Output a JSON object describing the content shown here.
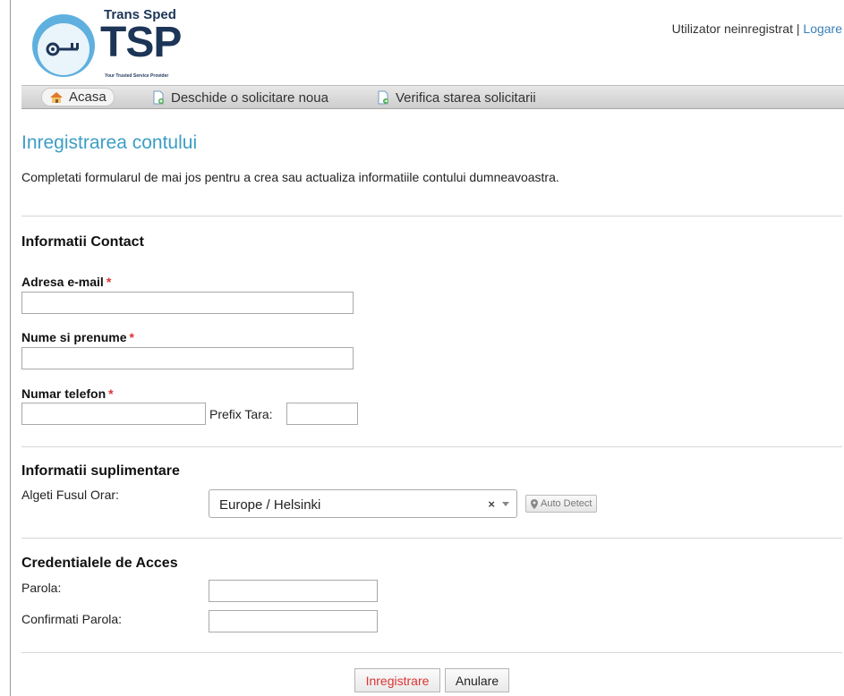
{
  "header": {
    "brand": "Trans Sped",
    "logo_text": "TSP",
    "tagline": "Your Trusted Service Provider",
    "user_status": "Utilizator neinregistrat",
    "separator": "|",
    "login_link": "Logare"
  },
  "nav": {
    "items": [
      {
        "label": "Acasa",
        "icon": "home-icon",
        "active": true
      },
      {
        "label": "Deschide o solicitare noua",
        "icon": "new-document-icon"
      },
      {
        "label": "Verifica starea solicitarii",
        "icon": "document-arrow-icon"
      }
    ]
  },
  "page": {
    "title": "Inregistrarea contului",
    "intro": "Completati formularul de mai jos pentru a crea sau actualiza informatiile contului dumneavoastra."
  },
  "contact": {
    "title": "Informatii Contact",
    "email_label": "Adresa e-mail",
    "name_label": "Nume si prenume",
    "phone_label": "Numar telefon",
    "prefix_label": "Prefix Tara:",
    "required_mark": "*",
    "email_value": "",
    "name_value": "",
    "phone_value": "",
    "prefix_value": ""
  },
  "extra": {
    "title": "Informatii suplimentare",
    "timezone_label": "Algeti Fusul Orar:",
    "timezone_value": "Europe / Helsinki",
    "clear_glyph": "×",
    "autodetect_label": "Auto Detect"
  },
  "credentials": {
    "title": "Credentialele de Acces",
    "password_label": "Parola:",
    "confirm_label": "Confirmati Parola:",
    "password_value": "",
    "confirm_value": ""
  },
  "actions": {
    "submit_label": "Inregistrare",
    "cancel_label": "Anulare"
  },
  "colors": {
    "accent_title": "#3d9ec4",
    "link": "#3a7fb8",
    "required": "#dd3333",
    "logo_blue": "#5fb0de",
    "logo_dark": "#1d3557"
  }
}
